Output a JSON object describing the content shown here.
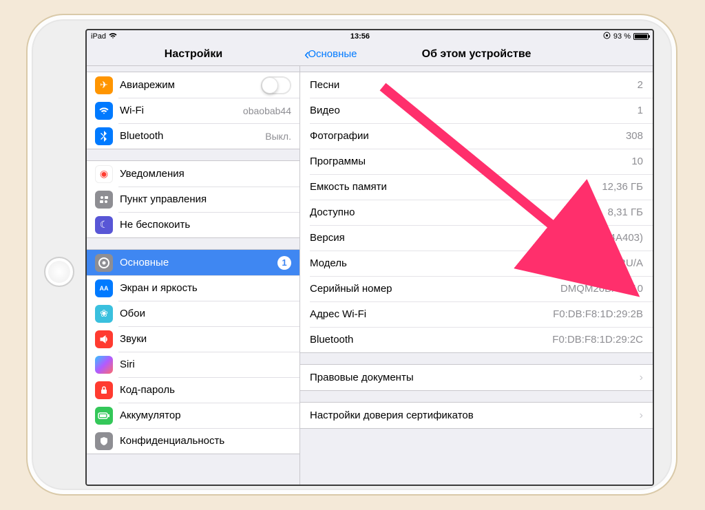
{
  "status": {
    "carrier": "iPad",
    "time": "13:56",
    "battery_pct": "93 %"
  },
  "nav": {
    "settings_title": "Настройки",
    "back_label": "Основные",
    "detail_title": "Об этом устройстве"
  },
  "sidebar": {
    "g1": {
      "airplane": "Авиарежим",
      "wifi": "Wi-Fi",
      "wifi_val": "obaobab44",
      "bt": "Bluetooth",
      "bt_val": "Выкл."
    },
    "g2": {
      "notif": "Уведомления",
      "control": "Пункт управления",
      "dnd": "Не беспокоить"
    },
    "g3": {
      "general": "Основные",
      "general_badge": "1",
      "display": "Экран и яркость",
      "wall": "Обои",
      "sounds": "Звуки",
      "siri": "Siri",
      "passcode": "Код-пароль",
      "battery": "Аккумулятор",
      "privacy": "Конфиденциальность"
    }
  },
  "detail_rows": {
    "songs_l": "Песни",
    "songs_v": "2",
    "videos_l": "Видео",
    "videos_v": "1",
    "photos_l": "Фотографии",
    "photos_v": "308",
    "apps_l": "Программы",
    "apps_v": "10",
    "capacity_l": "Емкость памяти",
    "capacity_v": "12,36 ГБ",
    "avail_l": "Доступно",
    "avail_v": "8,31 ГБ",
    "version_l": "Версия",
    "version_v": "10.0.1 (14A403)",
    "model_l": "Модель",
    "model_v": "MD785RU/A",
    "serial_l": "Серийный номер",
    "serial_v": "DMQM26BXFK10",
    "wifiaddr_l": "Адрес Wi-Fi",
    "wifiaddr_v": "F0:DB:F8:1D:29:2B",
    "btaddr_l": "Bluetooth",
    "btaddr_v": "F0:DB:F8:1D:29:2C"
  },
  "legal_l": "Правовые документы",
  "cert_l": "Настройки доверия сертификатов"
}
